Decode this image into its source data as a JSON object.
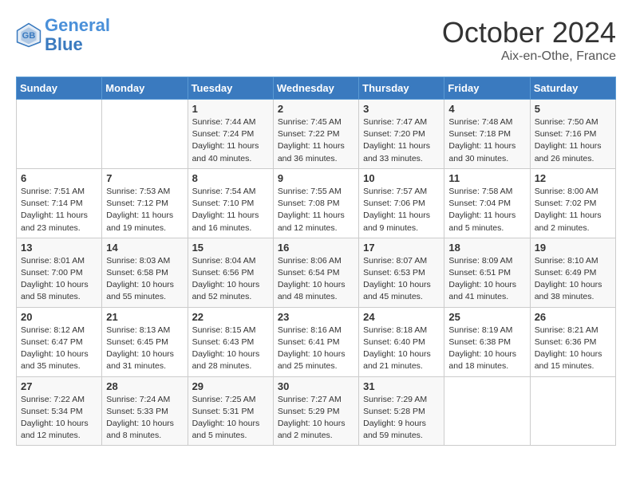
{
  "logo": {
    "line1": "General",
    "line2": "Blue"
  },
  "title": "October 2024",
  "location": "Aix-en-Othe, France",
  "weekdays": [
    "Sunday",
    "Monday",
    "Tuesday",
    "Wednesday",
    "Thursday",
    "Friday",
    "Saturday"
  ],
  "weeks": [
    [
      {
        "day": "",
        "info": ""
      },
      {
        "day": "",
        "info": ""
      },
      {
        "day": "1",
        "info": "Sunrise: 7:44 AM\nSunset: 7:24 PM\nDaylight: 11 hours\nand 40 minutes."
      },
      {
        "day": "2",
        "info": "Sunrise: 7:45 AM\nSunset: 7:22 PM\nDaylight: 11 hours\nand 36 minutes."
      },
      {
        "day": "3",
        "info": "Sunrise: 7:47 AM\nSunset: 7:20 PM\nDaylight: 11 hours\nand 33 minutes."
      },
      {
        "day": "4",
        "info": "Sunrise: 7:48 AM\nSunset: 7:18 PM\nDaylight: 11 hours\nand 30 minutes."
      },
      {
        "day": "5",
        "info": "Sunrise: 7:50 AM\nSunset: 7:16 PM\nDaylight: 11 hours\nand 26 minutes."
      }
    ],
    [
      {
        "day": "6",
        "info": "Sunrise: 7:51 AM\nSunset: 7:14 PM\nDaylight: 11 hours\nand 23 minutes."
      },
      {
        "day": "7",
        "info": "Sunrise: 7:53 AM\nSunset: 7:12 PM\nDaylight: 11 hours\nand 19 minutes."
      },
      {
        "day": "8",
        "info": "Sunrise: 7:54 AM\nSunset: 7:10 PM\nDaylight: 11 hours\nand 16 minutes."
      },
      {
        "day": "9",
        "info": "Sunrise: 7:55 AM\nSunset: 7:08 PM\nDaylight: 11 hours\nand 12 minutes."
      },
      {
        "day": "10",
        "info": "Sunrise: 7:57 AM\nSunset: 7:06 PM\nDaylight: 11 hours\nand 9 minutes."
      },
      {
        "day": "11",
        "info": "Sunrise: 7:58 AM\nSunset: 7:04 PM\nDaylight: 11 hours\nand 5 minutes."
      },
      {
        "day": "12",
        "info": "Sunrise: 8:00 AM\nSunset: 7:02 PM\nDaylight: 11 hours\nand 2 minutes."
      }
    ],
    [
      {
        "day": "13",
        "info": "Sunrise: 8:01 AM\nSunset: 7:00 PM\nDaylight: 10 hours\nand 58 minutes."
      },
      {
        "day": "14",
        "info": "Sunrise: 8:03 AM\nSunset: 6:58 PM\nDaylight: 10 hours\nand 55 minutes."
      },
      {
        "day": "15",
        "info": "Sunrise: 8:04 AM\nSunset: 6:56 PM\nDaylight: 10 hours\nand 52 minutes."
      },
      {
        "day": "16",
        "info": "Sunrise: 8:06 AM\nSunset: 6:54 PM\nDaylight: 10 hours\nand 48 minutes."
      },
      {
        "day": "17",
        "info": "Sunrise: 8:07 AM\nSunset: 6:53 PM\nDaylight: 10 hours\nand 45 minutes."
      },
      {
        "day": "18",
        "info": "Sunrise: 8:09 AM\nSunset: 6:51 PM\nDaylight: 10 hours\nand 41 minutes."
      },
      {
        "day": "19",
        "info": "Sunrise: 8:10 AM\nSunset: 6:49 PM\nDaylight: 10 hours\nand 38 minutes."
      }
    ],
    [
      {
        "day": "20",
        "info": "Sunrise: 8:12 AM\nSunset: 6:47 PM\nDaylight: 10 hours\nand 35 minutes."
      },
      {
        "day": "21",
        "info": "Sunrise: 8:13 AM\nSunset: 6:45 PM\nDaylight: 10 hours\nand 31 minutes."
      },
      {
        "day": "22",
        "info": "Sunrise: 8:15 AM\nSunset: 6:43 PM\nDaylight: 10 hours\nand 28 minutes."
      },
      {
        "day": "23",
        "info": "Sunrise: 8:16 AM\nSunset: 6:41 PM\nDaylight: 10 hours\nand 25 minutes."
      },
      {
        "day": "24",
        "info": "Sunrise: 8:18 AM\nSunset: 6:40 PM\nDaylight: 10 hours\nand 21 minutes."
      },
      {
        "day": "25",
        "info": "Sunrise: 8:19 AM\nSunset: 6:38 PM\nDaylight: 10 hours\nand 18 minutes."
      },
      {
        "day": "26",
        "info": "Sunrise: 8:21 AM\nSunset: 6:36 PM\nDaylight: 10 hours\nand 15 minutes."
      }
    ],
    [
      {
        "day": "27",
        "info": "Sunrise: 7:22 AM\nSunset: 5:34 PM\nDaylight: 10 hours\nand 12 minutes."
      },
      {
        "day": "28",
        "info": "Sunrise: 7:24 AM\nSunset: 5:33 PM\nDaylight: 10 hours\nand 8 minutes."
      },
      {
        "day": "29",
        "info": "Sunrise: 7:25 AM\nSunset: 5:31 PM\nDaylight: 10 hours\nand 5 minutes."
      },
      {
        "day": "30",
        "info": "Sunrise: 7:27 AM\nSunset: 5:29 PM\nDaylight: 10 hours\nand 2 minutes."
      },
      {
        "day": "31",
        "info": "Sunrise: 7:29 AM\nSunset: 5:28 PM\nDaylight: 9 hours\nand 59 minutes."
      },
      {
        "day": "",
        "info": ""
      },
      {
        "day": "",
        "info": ""
      }
    ]
  ]
}
